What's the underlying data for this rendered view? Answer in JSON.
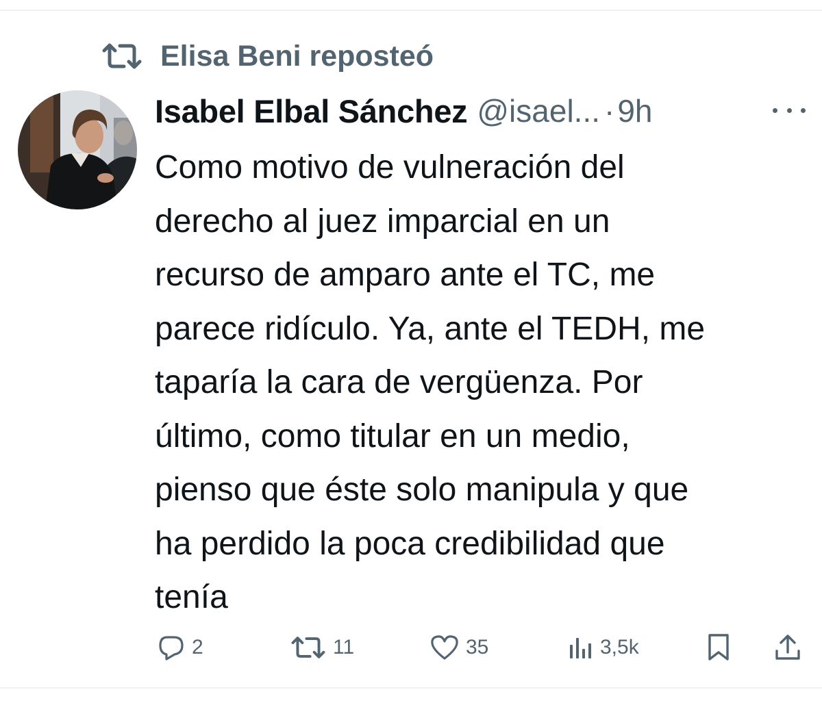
{
  "social_context": {
    "icon": "repost-icon",
    "text": "Elisa Beni reposteó"
  },
  "tweet": {
    "author": {
      "name": "Isabel Elbal Sánchez",
      "handle": "@isael...",
      "avatar_icon": "avatar-photo"
    },
    "separator": "·",
    "time": "9h",
    "more_icon": "more-icon",
    "text": "Como motivo de vulneración del\nderecho al juez imparcial en un\nrecurso de amparo ante el TC, me\nparece ridículo. Ya, ante el TEDH, me\ntaparía la cara de vergüenza. Por\núltimo, como titular en un medio,\npienso que éste solo manipula y que\nha perdido la poca credibilidad que\ntenía"
  },
  "actions": {
    "replies": {
      "icon": "reply-icon",
      "count": "2"
    },
    "reposts": {
      "icon": "repost-icon",
      "count": "11"
    },
    "likes": {
      "icon": "heart-icon",
      "count": "35"
    },
    "views": {
      "icon": "views-chart-icon",
      "count": "3,5k"
    },
    "bookmark": {
      "icon": "bookmark-icon"
    },
    "share": {
      "icon": "share-icon"
    }
  },
  "colors": {
    "text_primary": "#0f1419",
    "text_secondary": "#536471",
    "divider": "#eff3f4",
    "background": "#ffffff"
  }
}
